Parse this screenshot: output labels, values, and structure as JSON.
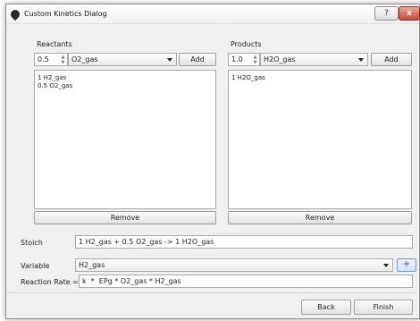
{
  "window": {
    "title": "Custom Kinetics Dialog",
    "help_symbol": "?",
    "close_symbol": "x"
  },
  "reactants": {
    "heading": "Reactants",
    "coefficient": "0.5",
    "species": "O2_gas",
    "add_label": "Add",
    "items": [
      "1 H2_gas",
      "0.5 O2_gas"
    ],
    "remove_label": "Remove"
  },
  "products": {
    "heading": "Products",
    "coefficient": "1.0",
    "species": "H2O_gas",
    "add_label": "Add",
    "items": [
      "1 H2O_gas"
    ],
    "remove_label": "Remove"
  },
  "stoich": {
    "label": "Stoich",
    "value": "1 H2_gas + 0.5 O2_gas -> 1 H2O_gas"
  },
  "variable": {
    "label": "Variable",
    "value": "H2_gas",
    "add_symbol": "+"
  },
  "rate": {
    "label": "Reaction Rate =",
    "value": "k  *  EPg * O2_gas * H2_gas"
  },
  "footer": {
    "back_label": "Back",
    "finish_label": "Finish"
  },
  "icons": {
    "app": "app-icon",
    "spin": "spin-arrows-icon",
    "dropdown": "chevron-down-icon"
  }
}
